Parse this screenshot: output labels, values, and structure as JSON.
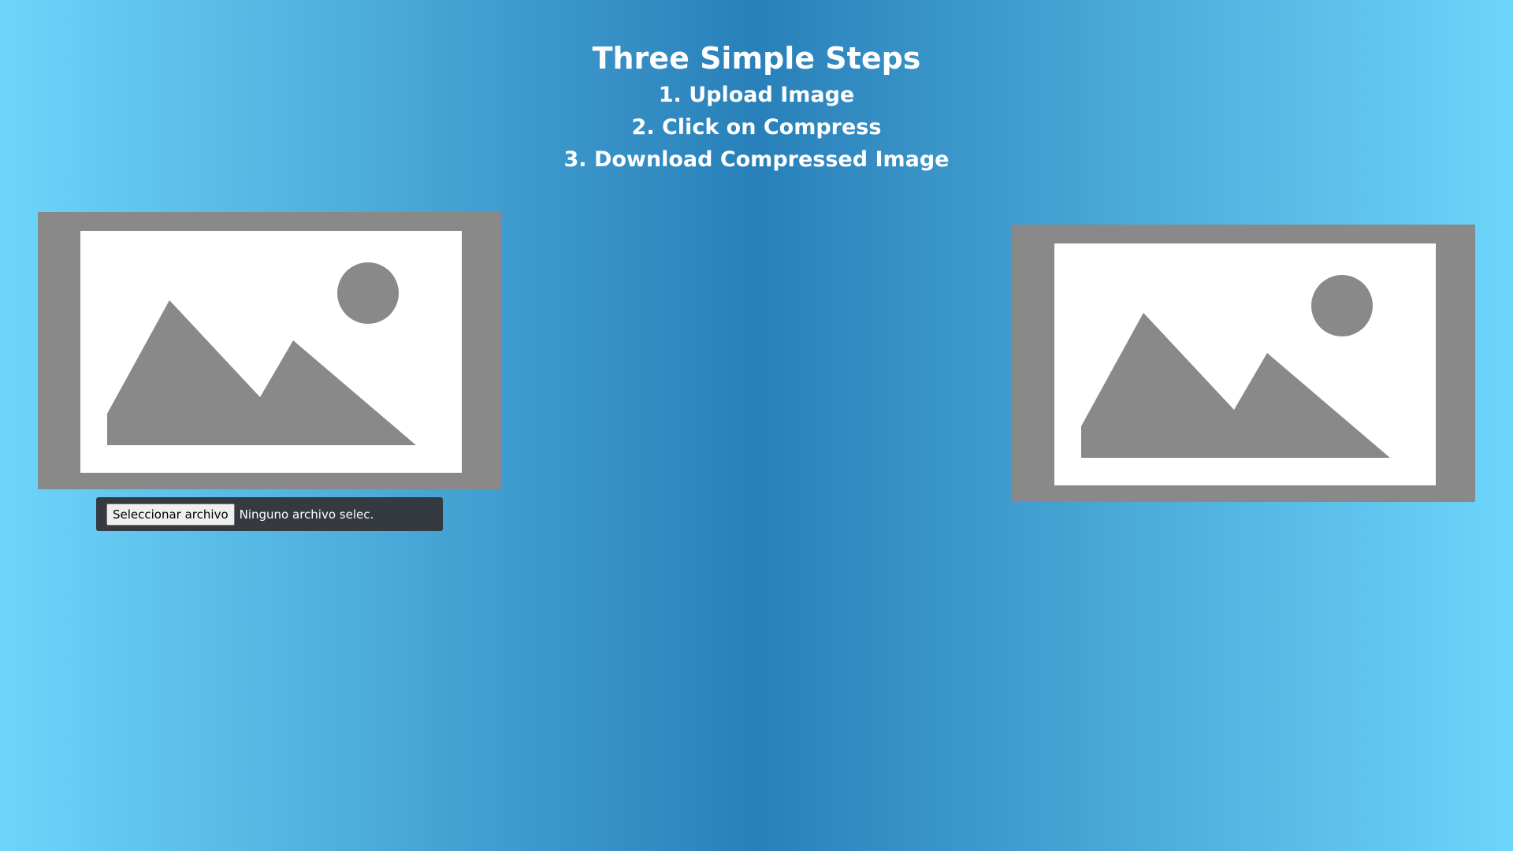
{
  "header": {
    "title": "Three Simple Steps",
    "steps": [
      "1. Upload Image",
      "2. Click on Compress",
      "3. Download Compressed Image"
    ]
  },
  "images": {
    "original": {
      "icon": "image-placeholder-icon"
    },
    "compressed": {
      "icon": "image-placeholder-icon"
    }
  },
  "file_input": {
    "button_label": "Seleccionar archivo",
    "status_text": "Ninguno archivo selec."
  },
  "colors": {
    "gradient_edge": "#6dd5fa",
    "gradient_center": "#2980b9",
    "placeholder_gray": "#898989",
    "file_box_bg": "#343a40"
  }
}
